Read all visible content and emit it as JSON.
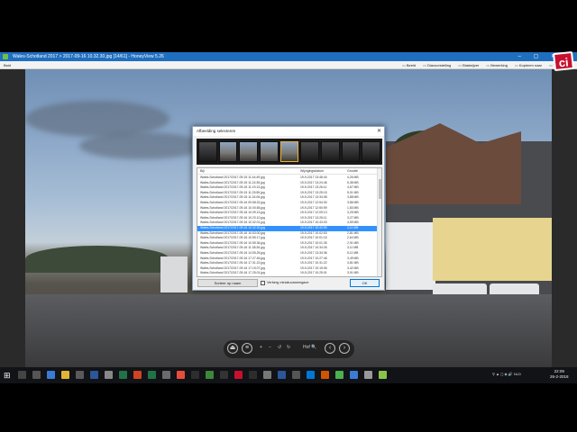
{
  "window": {
    "title": "Wales-Schotland 2017 > 2017-09-16 10.32.30.jpg [14/61] - HoneyView 5.26",
    "file_menu": "Bstd",
    "controls": "–  ▢  ✕"
  },
  "toolbar": {
    "items": [
      "Beeld",
      "Diavoorstelling",
      "Bladwijzer",
      "Bewerking",
      "Kopieren naar",
      "Verp"
    ]
  },
  "dialog": {
    "title": "Afbeelding selecteren",
    "close": "✕",
    "columns": {
      "name": "Bijl",
      "date": "Wijzigingsdatum",
      "size": "Grootte"
    },
    "rows": [
      {
        "name": "Wales-Schotland 2017\\2017-09-15 11.44.49.jpg",
        "date": "19-9-2017 13:48:44",
        "size": "4,26 MB"
      },
      {
        "name": "Wales-Schotland 2017\\2017-09-15 11.24.35.jpg",
        "date": "19-9-2017 13:24:46",
        "size": "5,38 MB"
      },
      {
        "name": "Wales-Schotland 2017\\2017-09-15 11.19.13.jpg",
        "date": "19-9-2017 13:26:11",
        "size": "4,67 MB"
      },
      {
        "name": "Wales-Schotland 2017\\2017-09-15 11.25.55.jpg",
        "date": "19-9-2017 13:25:15",
        "size": "5,01 MB"
      },
      {
        "name": "Wales-Schotland 2017\\2017-09-15 11.34.06.jpg",
        "date": "19-9-2017 13:34:08",
        "size": "3,88 MB"
      },
      {
        "name": "Wales-Schotland 2017\\2017-09-16 09.58.32.jpg",
        "date": "19-9-2017 12:54:30",
        "size": "3,86 MB"
      },
      {
        "name": "Wales-Schotland 2017\\2017-09-16 10.00.55.jpg",
        "date": "19-9-2017 12:50:59",
        "size": "1,83 MB"
      },
      {
        "name": "Wales-Schotland 2017\\2017-09-16 10.09.13.jpg",
        "date": "19-9-2017 12:09:13",
        "size": "3,25 MB"
      },
      {
        "name": "Wales-Schotland 2017\\2017-09-16 10.20.10.jpg",
        "date": "19-9-2017 13:26:11",
        "size": "3,27 MB"
      },
      {
        "name": "Wales-Schotland 2017\\2017-09-16 10.32.01.jpg",
        "date": "19-9-2017 10:43:03",
        "size": "4,59 MB"
      },
      {
        "name": "Wales-Schotland 2017\\2017-09-16 10.32.30.jpg",
        "date": "19-9-2017 10:42:59",
        "size": "4,11 MB"
      },
      {
        "name": "Wales-Schotland 2017\\2017-09-16 10.53.00.jpg",
        "date": "19-9-2017 10:02:53",
        "size": "2,81 MB"
      },
      {
        "name": "Wales-Schotland 2017\\2017-09-16 10.55.17.jpg",
        "date": "19-9-2017 10:01:15",
        "size": "2,64 MB"
      },
      {
        "name": "Wales-Schotland 2017\\2017-09-16 10.55.36.jpg",
        "date": "19-9-2017 10:01:35",
        "size": "2,91 MB"
      },
      {
        "name": "Wales-Schotland 2017\\2017-09-16 11.38.26.jpg",
        "date": "19-9-2017 10:34:26",
        "size": "3,11 MB"
      },
      {
        "name": "Wales-Schotland 2017\\2017-09-16 14.55.25.jpg",
        "date": "19-9-2017 13:34:36",
        "size": "5,11 MB"
      },
      {
        "name": "Wales-Schotland 2017\\2017-09-16 17.27.46.jpg",
        "date": "19-9-2017 10:27:46",
        "size": "3,49 MB"
      },
      {
        "name": "Wales-Schotland 2017\\2017-09-16 17.31.22.jpg",
        "date": "19-9-2017 10:31:22",
        "size": "3,81 MB"
      },
      {
        "name": "Wales-Schotland 2017\\2017-09-16 17.15.07.jpg",
        "date": "19-9-2017 10:15:06",
        "size": "3,42 MB"
      },
      {
        "name": "Wales-Schotland 2017\\2017-09-16 17.25.01.jpg",
        "date": "19-9-2017 10:25:01",
        "size": "3,91 MB"
      },
      {
        "name": "Wales-Schotland 2017\\2017-09-16 17.26.08.jpg",
        "date": "19-9-2017 10:26:08",
        "size": "3,97 MB"
      },
      {
        "name": "Wales-Schotland 2017\\2017-09-16 17.35.09.jpg",
        "date": "19-9-2017 10:35:09",
        "size": "4,44 MB"
      }
    ],
    "sort_button": "Sorteer op naam",
    "checkbox_label": "Verberg miniatuurweergave",
    "ok_button": "OK"
  },
  "viewer_controls": {
    "zoom": "Hof 🔍"
  },
  "taskbar": {
    "tray_text": "NLD",
    "time": "22:09",
    "date": "26-2-2018"
  },
  "logo": {
    "text": "ci"
  }
}
